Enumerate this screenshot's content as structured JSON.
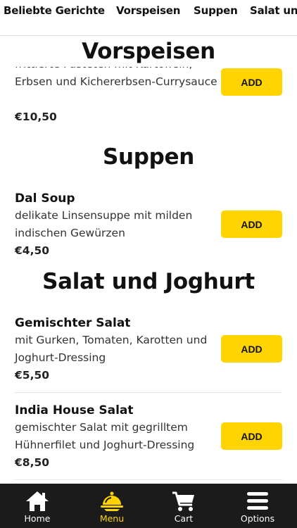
{
  "tabs": [
    "Beliebte Gerichte",
    "Vorspeisen",
    "Suppen",
    "Salat und Joghurt"
  ],
  "sections": {
    "vorspeisen": {
      "title": "Vorspeisen",
      "item": {
        "desc_partial": "frittierte Pasteten mit Kartoffeln, Erbsen und Kichererbsen-Currysauce",
        "price": "€10,50",
        "add_label": "ADD"
      }
    },
    "suppen": {
      "title": "Suppen",
      "items": [
        {
          "name": "Dal Soup",
          "desc": "delikate Linsensuppe mit milden indischen Gewürzen",
          "price": "€4,50",
          "add_label": "ADD"
        }
      ]
    },
    "salat": {
      "title": "Salat und Joghurt",
      "items": [
        {
          "name": "Gemischter Salat",
          "desc": "mit Gurken, Tomaten, Karotten und Joghurt-Dressing",
          "price": "€5,50",
          "add_label": "ADD"
        },
        {
          "name": "India House Salat",
          "desc": "gemischter Salat mit gegrilltem Hühnerfilet und Joghurt-Dressing",
          "price": "€8,50",
          "add_label": "ADD"
        }
      ]
    }
  },
  "nav": {
    "active": "Menu",
    "accent": "#ffd400",
    "items": [
      {
        "label": "Home",
        "icon": "home-icon"
      },
      {
        "label": "Menu",
        "icon": "cloche-icon"
      },
      {
        "label": "Cart",
        "icon": "cart-icon"
      },
      {
        "label": "Options",
        "icon": "menu-icon"
      }
    ]
  }
}
